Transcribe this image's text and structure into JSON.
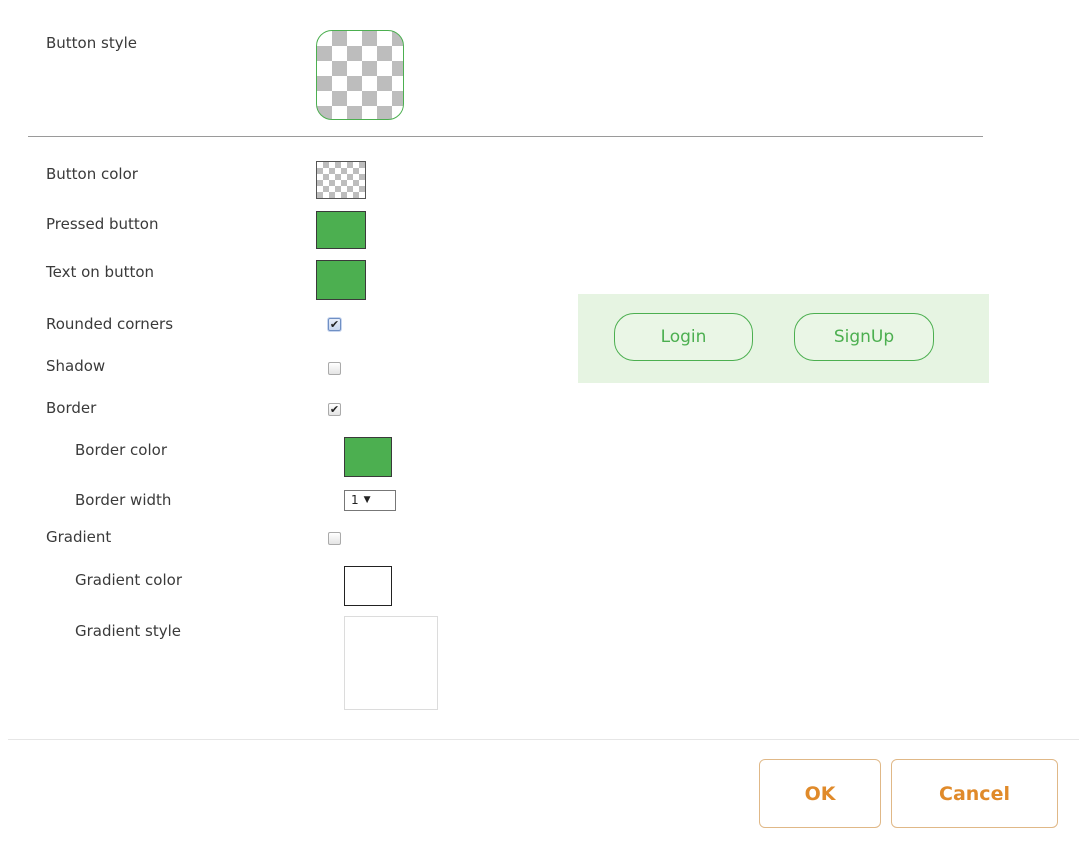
{
  "form": {
    "button_style_label": "Button style",
    "button_color_label": "Button color",
    "pressed_button_label": "Pressed button",
    "text_on_button_label": "Text on button",
    "rounded_corners_label": "Rounded corners",
    "rounded_corners_checked": true,
    "shadow_label": "Shadow",
    "shadow_checked": false,
    "border_label": "Border",
    "border_checked": true,
    "border_color_label": "Border color",
    "border_width_label": "Border width",
    "border_width_value": "1",
    "gradient_label": "Gradient",
    "gradient_checked": false,
    "gradient_color_label": "Gradient color",
    "gradient_style_label": "Gradient style"
  },
  "colors": {
    "accent_green": "#4caf50",
    "preview_background": "#e6f4e2",
    "footer_button_text": "#e08a2a",
    "footer_button_border": "#e0b887"
  },
  "preview": {
    "login_label": "Login",
    "signup_label": "SignUp"
  },
  "footer": {
    "ok_label": "OK",
    "cancel_label": "Cancel"
  }
}
